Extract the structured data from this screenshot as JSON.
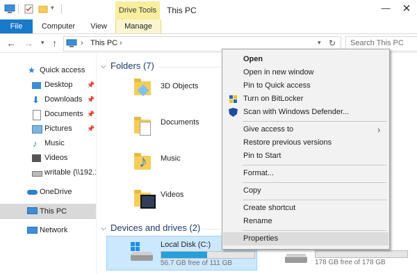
{
  "titlebar": {
    "drive_tools": "Drive Tools",
    "title": "This PC"
  },
  "ribbon": {
    "file": "File",
    "computer": "Computer",
    "view": "View",
    "manage": "Manage"
  },
  "address": {
    "location": "This PC",
    "search_placeholder": "Search This PC"
  },
  "sidebar": {
    "quick_access": "Quick access",
    "items": [
      "Desktop",
      "Downloads",
      "Documents",
      "Pictures",
      "Music",
      "Videos",
      "writable (\\\\192.1"
    ],
    "onedrive": "OneDrive",
    "this_pc": "This PC",
    "network": "Network"
  },
  "content": {
    "folders_header": "Folders (7)",
    "folders": [
      "3D Objects",
      "Documents",
      "Music",
      "Videos"
    ],
    "devices_header": "Devices and drives (2)",
    "drive1": {
      "name": "Local Disk (C:)",
      "free": "56.7 GB free of 111 GB",
      "used_fraction": 0.49
    },
    "drive2": {
      "free": "178 GB free of 178 GB",
      "used_fraction": 0.0
    }
  },
  "menu": {
    "open": "Open",
    "open_new_window": "Open in new window",
    "pin_quick": "Pin to Quick access",
    "bitlocker": "Turn on BitLocker",
    "defender": "Scan with Windows Defender...",
    "give_access": "Give access to",
    "restore": "Restore previous versions",
    "pin_start": "Pin to Start",
    "format": "Format...",
    "copy": "Copy",
    "create_shortcut": "Create shortcut",
    "rename": "Rename",
    "properties": "Properties"
  },
  "colors": {
    "accent": "#1979ca",
    "drive_tools": "#f7ee9e",
    "selection": "#cce8ff",
    "bar": "#26a0da"
  }
}
